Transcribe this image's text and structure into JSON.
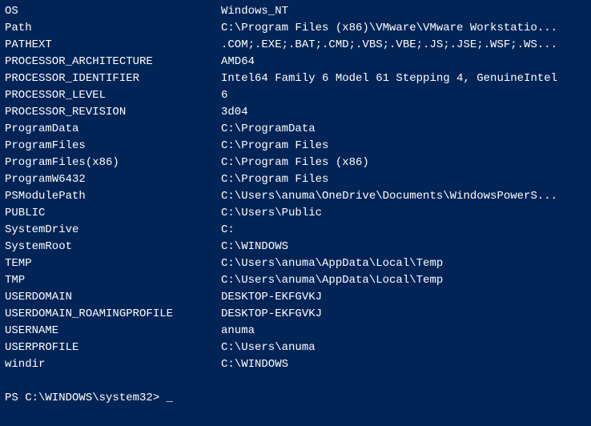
{
  "env_vars": [
    {
      "name": "OS",
      "value": "Windows_NT"
    },
    {
      "name": "Path",
      "value": "C:\\Program Files (x86)\\VMware\\VMware Workstatio..."
    },
    {
      "name": "PATHEXT",
      "value": ".COM;.EXE;.BAT;.CMD;.VBS;.VBE;.JS;.JSE;.WSF;.WS..."
    },
    {
      "name": "PROCESSOR_ARCHITECTURE",
      "value": "AMD64"
    },
    {
      "name": "PROCESSOR_IDENTIFIER",
      "value": "Intel64 Family 6 Model 61 Stepping 4, GenuineIntel"
    },
    {
      "name": "PROCESSOR_LEVEL",
      "value": "6"
    },
    {
      "name": "PROCESSOR_REVISION",
      "value": "3d04"
    },
    {
      "name": "ProgramData",
      "value": "C:\\ProgramData"
    },
    {
      "name": "ProgramFiles",
      "value": "C:\\Program Files"
    },
    {
      "name": "ProgramFiles(x86)",
      "value": "C:\\Program Files (x86)"
    },
    {
      "name": "ProgramW6432",
      "value": "C:\\Program Files"
    },
    {
      "name": "PSModulePath",
      "value": "C:\\Users\\anuma\\OneDrive\\Documents\\WindowsPowerS..."
    },
    {
      "name": "PUBLIC",
      "value": "C:\\Users\\Public"
    },
    {
      "name": "SystemDrive",
      "value": "C:"
    },
    {
      "name": "SystemRoot",
      "value": "C:\\WINDOWS"
    },
    {
      "name": "TEMP",
      "value": "C:\\Users\\anuma\\AppData\\Local\\Temp"
    },
    {
      "name": "TMP",
      "value": "C:\\Users\\anuma\\AppData\\Local\\Temp"
    },
    {
      "name": "USERDOMAIN",
      "value": "DESKTOP-EKFGVKJ"
    },
    {
      "name": "USERDOMAIN_ROAMINGPROFILE",
      "value": "DESKTOP-EKFGVKJ"
    },
    {
      "name": "USERNAME",
      "value": "anuma"
    },
    {
      "name": "USERPROFILE",
      "value": "C:\\Users\\anuma"
    },
    {
      "name": "windir",
      "value": "C:\\WINDOWS"
    }
  ],
  "prompt": "PS C:\\WINDOWS\\system32>",
  "cursor": "_"
}
